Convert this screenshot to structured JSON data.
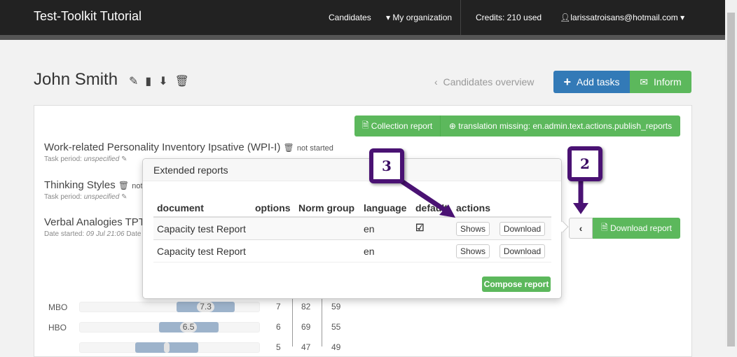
{
  "navbar": {
    "brand": "Test-Toolkit Tutorial",
    "candidates": "Candidates",
    "organization": "My organization",
    "credits": "Credits: 210 used",
    "user": "larissatroisans@hotmail.com"
  },
  "header": {
    "name": "John Smith",
    "back_link": "Candidates overview",
    "add_tasks": "Add tasks",
    "inform": "Inform"
  },
  "actions": {
    "collection_report": "Collection report",
    "publish": "translation missing: en.admin.text.actions.publish_reports",
    "download_report": "Download report"
  },
  "tasks": [
    {
      "title": "Work-related Personality Inventory Ipsative (WPI-I)",
      "status": "not started",
      "period_label": "Task period:",
      "period": "unspecified"
    },
    {
      "title": "Thinking Styles",
      "status": "not started",
      "period_label": "Task period:",
      "period": "unspecified"
    },
    {
      "title": "Verbal Analogies TPT",
      "date_label": "Date started:",
      "date": "09 Jul 21:06",
      "date2_label": "Date"
    }
  ],
  "popover": {
    "title": "Extended reports",
    "columns": [
      "document",
      "options",
      "Norm group",
      "language",
      "default",
      "actions"
    ],
    "rows": [
      {
        "document": "Capacity test Report",
        "language": "en",
        "default": true,
        "show": "Shows",
        "download": "Download"
      },
      {
        "document": "Capacity test Report",
        "language": "en",
        "default": false,
        "show": "Shows",
        "download": "Download"
      }
    ],
    "compose": "Compose report"
  },
  "callouts": [
    "3",
    "2"
  ],
  "scores": [
    {
      "label": "MBO",
      "value": "7.3",
      "fill": [
        0.54,
        0.86
      ],
      "a": "7",
      "b": "82",
      "c": "59"
    },
    {
      "label": "HBO",
      "value": "6.5",
      "fill": [
        0.44,
        0.77
      ],
      "a": "6",
      "b": "69",
      "c": "55"
    },
    {
      "label": "",
      "value": "",
      "fill": [
        0.31,
        0.66
      ],
      "a": "5",
      "b": "47",
      "c": "49"
    }
  ],
  "colors": {
    "green": "#5cb85c",
    "blue": "#337ab7",
    "callout": "#4a1273"
  }
}
